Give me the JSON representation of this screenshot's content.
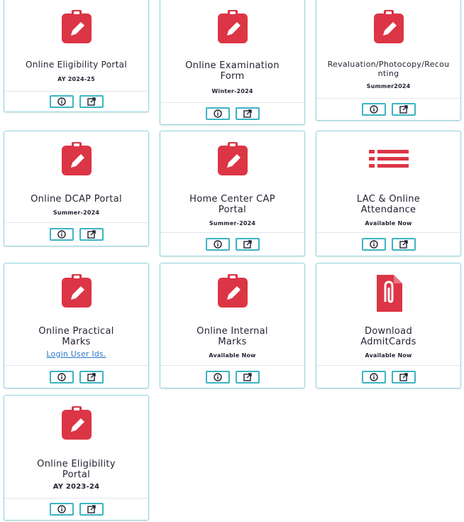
{
  "colors": {
    "accent": "#dc3545",
    "border": "#3cb4c4",
    "link": "#2a75c9"
  },
  "cards": [
    {
      "title": "Online Eligibility Portal",
      "subtitle": "AY 2024-25",
      "icon": "clipboard-pencil-icon"
    },
    {
      "title": "Online Examination Form",
      "subtitle": "Winter-2024",
      "icon": "clipboard-pencil-icon"
    },
    {
      "title": "Revaluation/Photocopy/Recounting",
      "subtitle": "Summer2024",
      "icon": "clipboard-pencil-icon"
    },
    {
      "title": "Online DCAP Portal",
      "subtitle": "Summer-2024",
      "icon": "clipboard-pencil-icon"
    },
    {
      "title": "Home Center CAP Portal",
      "subtitle": "Summer-2024",
      "icon": "clipboard-pencil-icon"
    },
    {
      "title": "LAC & Online Attendance",
      "subtitle": "Available Now",
      "icon": "list-icon"
    },
    {
      "title": "Online Practical Marks",
      "subtitle": "Login User Ids.",
      "icon": "clipboard-pencil-icon"
    },
    {
      "title": "Online Internal Marks",
      "subtitle": "Available Now",
      "icon": "clipboard-pencil-icon"
    },
    {
      "title": "Download AdmitCards",
      "subtitle": "Available Now",
      "icon": "file-attachment-icon"
    },
    {
      "title": "Online Eligibility Portal",
      "subtitle": "AY 2023-24",
      "icon": "clipboard-pencil-icon"
    }
  ]
}
